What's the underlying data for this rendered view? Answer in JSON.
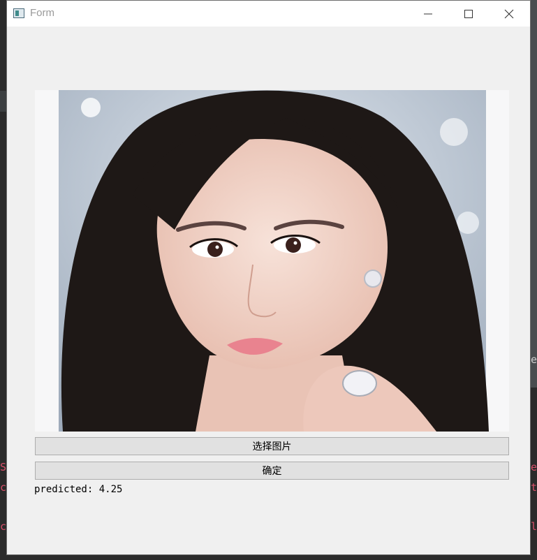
{
  "window": {
    "title": "Form",
    "controls": {
      "minimize": "minimize-icon",
      "maximize": "maximize-icon",
      "close": "close-icon"
    }
  },
  "image_panel": {
    "content": "Portrait photo of a woman with long dark hair, hand with ring near chin",
    "colors": {
      "background": "#ffffff",
      "hair": "#1e1816",
      "skin": "#f3d7cd",
      "backdrop": "#b9c4d0"
    }
  },
  "buttons": {
    "select_image": "选择图片",
    "confirm": "确定"
  },
  "result": {
    "text": "predicted: 4.25"
  },
  "background_fragments": {
    "right": [
      "e",
      "e",
      "t",
      "l"
    ],
    "left": [
      "S",
      "c",
      "c"
    ]
  }
}
